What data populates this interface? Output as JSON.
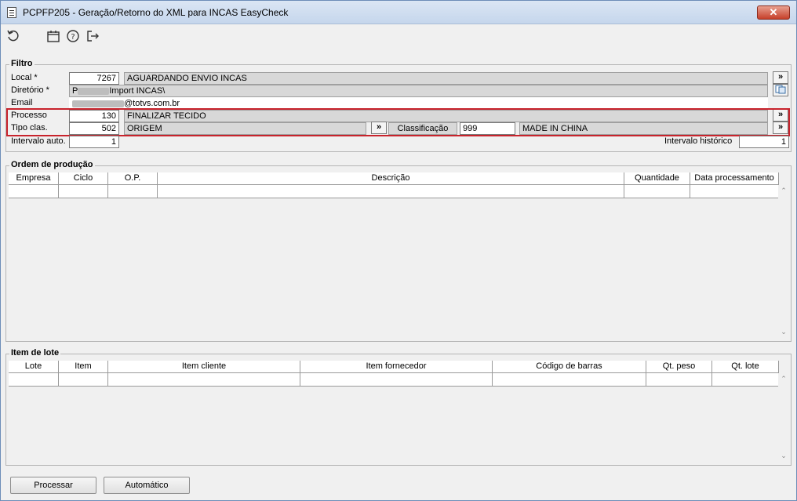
{
  "window": {
    "title": "PCPFP205 - Geração/Retorno do XML para INCAS EasyCheck",
    "close": "✕"
  },
  "toolbar": {
    "refresh": "refresh-icon",
    "calendar": "calendar-icon",
    "help": "help-icon",
    "exit": "exit-icon"
  },
  "filtro": {
    "title": "Filtro",
    "local": {
      "label": "Local *",
      "code": "7267",
      "desc": "AGUARDANDO ENVIO INCAS"
    },
    "diretorio": {
      "label": "Diretório *",
      "prefix": "P",
      "value": "Import INCAS\\"
    },
    "email": {
      "label": "Email",
      "value": "@totvs.com.br"
    },
    "processo": {
      "label": "Processo",
      "code": "130",
      "desc": "FINALIZAR TECIDO"
    },
    "tipo_clas": {
      "label": "Tipo clas.",
      "code": "502",
      "desc": "ORIGEM"
    },
    "classificacao": {
      "label": "Classificação",
      "code": "999",
      "desc": "MADE IN CHINA"
    },
    "intervalo_auto": {
      "label": "Intervalo auto.",
      "value": "1"
    },
    "intervalo_historico": {
      "label": "Intervalo histórico",
      "value": "1"
    },
    "lookup": "»"
  },
  "ordem": {
    "title": "Ordem de produção",
    "columns": [
      "Empresa",
      "Ciclo",
      "O.P.",
      "Descrição",
      "Quantidade",
      "Data processamento"
    ]
  },
  "lote": {
    "title": "Item de lote",
    "columns": [
      "Lote",
      "Item",
      "Item cliente",
      "Item fornecedor",
      "Código de barras",
      "Qt. peso",
      "Qt. lote"
    ]
  },
  "buttons": {
    "processar": "Processar",
    "automatico": "Automático"
  }
}
